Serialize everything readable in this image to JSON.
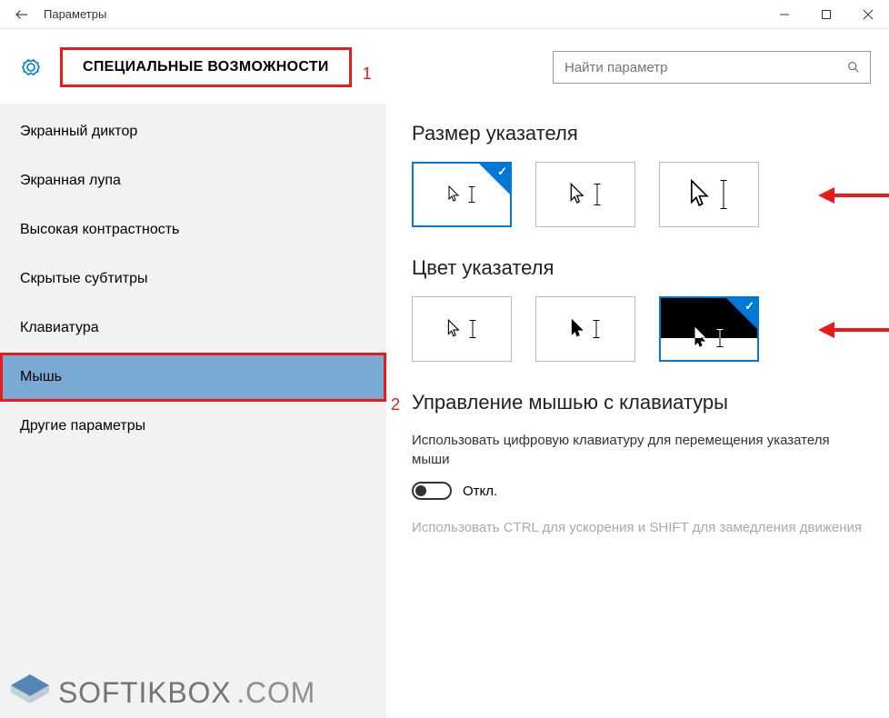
{
  "window": {
    "title": "Параметры"
  },
  "header": {
    "section_title": "СПЕЦИАЛЬНЫЕ ВОЗМОЖНОСТИ",
    "search_placeholder": "Найти параметр"
  },
  "sidebar": {
    "items": [
      {
        "label": "Экранный диктор"
      },
      {
        "label": "Экранная лупа"
      },
      {
        "label": "Высокая контрастность"
      },
      {
        "label": "Скрытые субтитры"
      },
      {
        "label": "Клавиатура"
      },
      {
        "label": "Мышь"
      },
      {
        "label": "Другие параметры"
      }
    ],
    "selected_index": 5
  },
  "content": {
    "pointer_size_heading": "Размер указателя",
    "pointer_size_selected": 0,
    "pointer_color_heading": "Цвет указателя",
    "pointer_color_selected": 2,
    "mouse_keys_heading": "Управление мышью с клавиатуры",
    "mouse_keys_desc": "Использовать цифровую клавиатуру для перемещения указателя мыши",
    "toggle_state_label": "Откл.",
    "disabled_desc": "Использовать CTRL для ускорения и SHIFT для замедления движения"
  },
  "annotations": {
    "marker1": "1",
    "marker2": "2"
  },
  "watermark": {
    "text": "SOFTIKBOX",
    "suffix": ".COM"
  }
}
